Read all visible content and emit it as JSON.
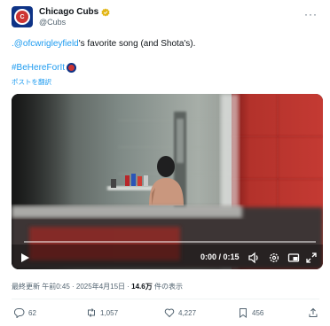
{
  "account": {
    "display_name": "Chicago Cubs",
    "handle": "@Cubs",
    "avatar_icon": "cubs-logo-icon",
    "verified_icon": "gold-verified-badge-icon",
    "brand_blue": "#0e3386",
    "brand_red": "#cc3433"
  },
  "tweet": {
    "mention": ".@ofcwrigleyfield",
    "text_rest": "'s favorite song (and Shota's).",
    "hashtag": "#BeHereForIt",
    "hashflag_icon": "cubs-hashflag-icon",
    "translate_label": "ポストを翻訳",
    "link_color": "#1d9bf0"
  },
  "video": {
    "time_display": "0:00 / 0:15",
    "progress": 0,
    "controls": [
      "play-icon",
      "volume-icon",
      "settings-icon",
      "fullscreen-exit-icon",
      "fullscreen-icon"
    ]
  },
  "meta": {
    "prefix": "最終更新 午前0:45 · 2025年4月15日 · ",
    "views_count": "14.6万",
    "views_suffix": " 件の表示"
  },
  "actions": {
    "replies": "62",
    "reposts": "1,057",
    "likes": "4,227",
    "bookmarks": "456",
    "icons": [
      "reply-icon",
      "repost-icon",
      "like-icon",
      "bookmark-icon",
      "share-icon"
    ]
  },
  "more_icon_label": "···"
}
